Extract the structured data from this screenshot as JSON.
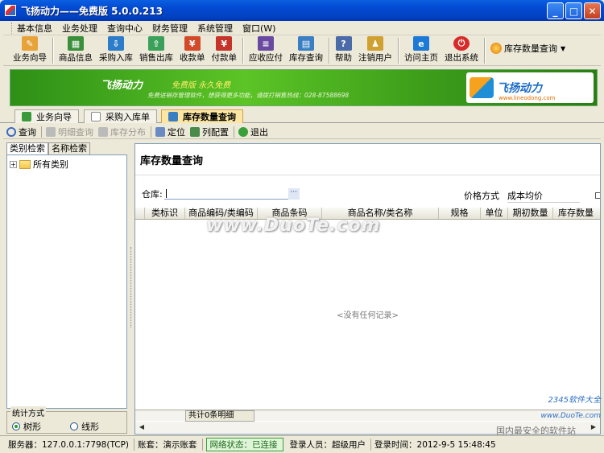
{
  "window": {
    "title": "飞扬动力——免费版  5.0.0.213"
  },
  "menu": [
    "基本信息",
    "业务处理",
    "查询中心",
    "财务管理",
    "系统管理",
    "窗口(W)"
  ],
  "toolbar": {
    "buttons": [
      {
        "label": "业务向导",
        "icon": "wizard-icon",
        "color": "#e8a23a"
      },
      {
        "label": "商品信息",
        "icon": "goods-icon",
        "color": "#3a8f3a"
      },
      {
        "label": "采购入库",
        "icon": "purchase-icon",
        "color": "#2c7cc9"
      },
      {
        "label": "销售出库",
        "icon": "sales-icon",
        "color": "#3aa05a"
      },
      {
        "label": "收款单",
        "icon": "receipt-icon",
        "color": "#d24a2a"
      },
      {
        "label": "付款单",
        "icon": "payment-icon",
        "color": "#c4342a"
      },
      {
        "label": "应收应付",
        "icon": "receivable-icon",
        "color": "#6a4aa0"
      },
      {
        "label": "库存查询",
        "icon": "stock-query-icon",
        "color": "#3a7ec4"
      },
      {
        "label": "帮助",
        "icon": "help-icon",
        "color": "#4a6aa8"
      },
      {
        "label": "注销用户",
        "icon": "logout-user-icon",
        "color": "#d0a030"
      },
      {
        "label": "访问主页",
        "icon": "homepage-icon",
        "color": "#1c7ad6"
      },
      {
        "label": "退出系统",
        "icon": "exit-icon",
        "color": "#d82a2a"
      }
    ],
    "dropdown_label": "库存数量查询"
  },
  "banner": {
    "slogan": "飞扬动力",
    "free_text": "免费版  永久免费",
    "sub_text": "免费进销存管理软件，想获得更多功能，请拨打销售热线：028-87588698",
    "logo_text": "飞扬动力",
    "logo_url": "www.lineodong.com"
  },
  "tabs": [
    {
      "label": "业务向导",
      "active": false
    },
    {
      "label": "采购入库单",
      "active": false
    },
    {
      "label": "库存数量查询",
      "active": true
    }
  ],
  "subbar": [
    {
      "label": "查询",
      "enabled": true,
      "icon": "search-icon"
    },
    {
      "label": "明细查询",
      "enabled": false,
      "icon": "detail-icon"
    },
    {
      "label": "库存分布",
      "enabled": false,
      "icon": "distribution-icon"
    },
    {
      "label": "定位",
      "enabled": true,
      "icon": "locate-icon"
    },
    {
      "label": "列配置",
      "enabled": true,
      "icon": "columns-icon"
    },
    {
      "label": "退出",
      "enabled": true,
      "icon": "exit-icon"
    }
  ],
  "leftpanel": {
    "tabs": [
      "类别检索",
      "名称检索"
    ],
    "tree_root": "所有类别",
    "stats_legend": "统计方式",
    "radio_tree": "树形",
    "radio_line": "线形"
  },
  "main": {
    "heading": "库存数量查询",
    "warehouse_label": "仓库:",
    "warehouse_value": "",
    "price_method_label": "价格方式",
    "price_method_value": "成本均价",
    "columns": [
      "类标识",
      "商品编码/类编码",
      "商品条码",
      "商品名称/类名称",
      "规格",
      "单位",
      "期初数量",
      "库存数量"
    ],
    "empty_text": "<没有任何记录>",
    "footer_count": "共计0条明细"
  },
  "statusbar": {
    "server": "服务器：127.0.0.1:7798(TCP)",
    "account": "账套：演示账套",
    "network": "网络状态：已连接",
    "user": "登录人员：超级用户",
    "login_time": "登录时间：2012-9-5  15:48:45"
  },
  "watermarks": {
    "main": "www.DuoTe.com",
    "corner1": "2345软件大全",
    "corner2": "www.DuoTe.com",
    "corner3": "国内最安全的软件站"
  }
}
